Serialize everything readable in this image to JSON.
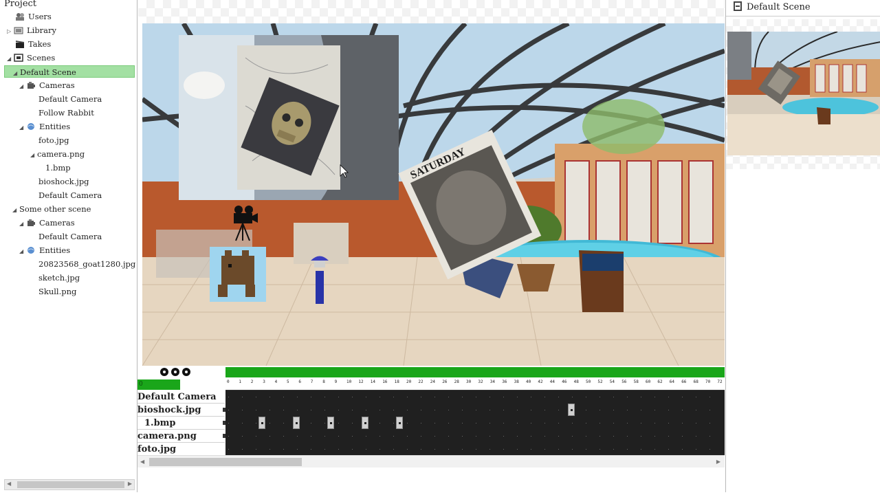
{
  "project": {
    "title": "Project",
    "tree": [
      {
        "label": "Users",
        "icon": "users-icon",
        "indent": 1,
        "arrow": ""
      },
      {
        "label": "Library",
        "icon": "library-icon",
        "indent": 1,
        "arrow": "▷"
      },
      {
        "label": "Takes",
        "icon": "clapper-icon",
        "indent": 1,
        "arrow": ""
      },
      {
        "label": "Scenes",
        "icon": "film-icon",
        "indent": 1,
        "arrow": "◢"
      },
      {
        "label": "Default Scene",
        "icon": "",
        "indent": 2,
        "arrow": "◢",
        "selected": true
      },
      {
        "label": "Cameras",
        "icon": "camera-icon",
        "indent": 3,
        "arrow": "◢"
      },
      {
        "label": "Default Camera",
        "icon": "",
        "indent": 4,
        "arrow": ""
      },
      {
        "label": "Follow Rabbit",
        "icon": "",
        "indent": 4,
        "arrow": ""
      },
      {
        "label": "Entities",
        "icon": "globe-icon",
        "indent": 3,
        "arrow": "◢"
      },
      {
        "label": "foto.jpg",
        "icon": "",
        "indent": 4,
        "arrow": ""
      },
      {
        "label": "camera.png",
        "icon": "",
        "indent": 4,
        "arrow": "◢"
      },
      {
        "label": "1.bmp",
        "icon": "",
        "indent": 5,
        "arrow": ""
      },
      {
        "label": "bioshock.jpg",
        "icon": "",
        "indent": 4,
        "arrow": ""
      },
      {
        "label": "Default Camera",
        "icon": "",
        "indent": 4,
        "arrow": ""
      },
      {
        "label": "Some other scene",
        "icon": "",
        "indent": 2,
        "arrow": "◢"
      },
      {
        "label": "Cameras",
        "icon": "camera-icon",
        "indent": 3,
        "arrow": "◢"
      },
      {
        "label": "Default Camera",
        "icon": "",
        "indent": 4,
        "arrow": ""
      },
      {
        "label": "Entities",
        "icon": "globe-icon",
        "indent": 3,
        "arrow": "◢"
      },
      {
        "label": "20823568_goat1280.jpg",
        "icon": "",
        "indent": 4,
        "arrow": ""
      },
      {
        "label": "sketch.jpg",
        "icon": "",
        "indent": 4,
        "arrow": ""
      },
      {
        "label": "Skull.png",
        "icon": "",
        "indent": 4,
        "arrow": ""
      }
    ]
  },
  "timeline": {
    "frame_indicator": "0",
    "ruler_ticks": [
      "0",
      "1",
      "2",
      "3",
      "4",
      "5",
      "6",
      "7",
      "8",
      "9",
      "10",
      "12",
      "14",
      "16",
      "18",
      "20",
      "22",
      "24",
      "26",
      "28",
      "30",
      "32",
      "34",
      "36",
      "38",
      "40",
      "42",
      "44",
      "46",
      "48",
      "50",
      "52",
      "54",
      "56",
      "58",
      "60",
      "62",
      "64",
      "66",
      "68",
      "70",
      "72"
    ],
    "tracks": [
      {
        "label": "Default Camera",
        "indent": false,
        "keyframes": []
      },
      {
        "label": "bioshock.jpg",
        "indent": false,
        "keyframes": [
          50
        ]
      },
      {
        "label": "1.bmp",
        "indent": true,
        "keyframes": [
          5,
          10,
          15,
          20,
          25
        ]
      },
      {
        "label": "camera.png",
        "indent": false,
        "keyframes": []
      },
      {
        "label": "foto.jpg",
        "indent": false,
        "keyframes": []
      }
    ],
    "transport_buttons": [
      "play-button",
      "pause-button",
      "stop-button"
    ]
  },
  "preview": {
    "title": "Default Scene"
  },
  "colors": {
    "accent_green": "#1aa61a",
    "selection": "#a3e0a3",
    "track_bg": "#202020"
  }
}
